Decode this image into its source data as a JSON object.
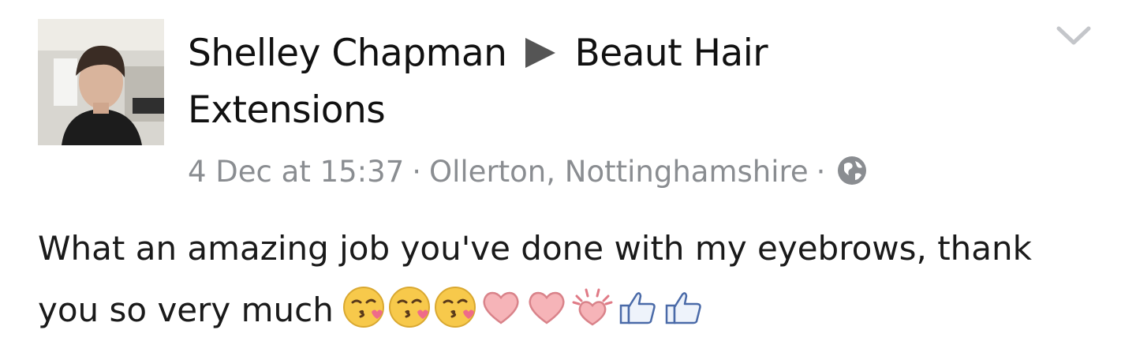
{
  "post": {
    "author": "Shelley Chapman",
    "target_page": "Beaut Hair Extensions",
    "date": "4 Dec at 15:37",
    "location": "Ollerton, Nottinghamshire",
    "separator": "·",
    "privacy_icon": "globe-icon",
    "menu_icon": "chevron-down-icon",
    "text": "What an amazing job you've done with my eyebrows, thank you so very much",
    "emojis": [
      "kissing-face-with-heart",
      "kissing-face-with-heart",
      "kissing-face-with-heart",
      "heart",
      "heart",
      "growing-heart",
      "thumbs-up",
      "thumbs-up"
    ]
  },
  "colors": {
    "background": "#ffffff",
    "text": "#1a1a1a",
    "meta": "#8a8d91",
    "arrow": "#555555"
  }
}
